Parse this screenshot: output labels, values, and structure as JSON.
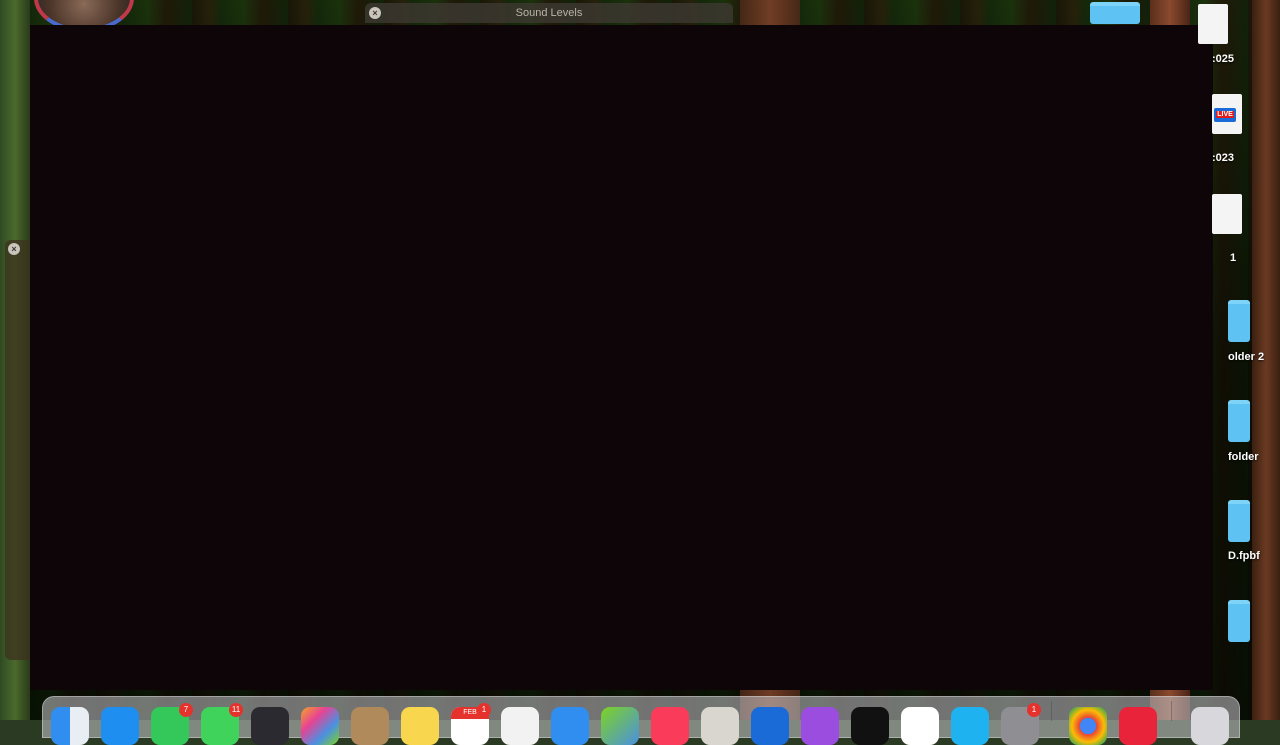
{
  "window": {
    "title": "Sound Levels"
  },
  "desktop_icons": [
    {
      "label": ":025",
      "kind": "document"
    },
    {
      "label": ":023",
      "kind": "document-live"
    },
    {
      "label": "1",
      "kind": "document"
    },
    {
      "label": "older 2",
      "kind": "folder"
    },
    {
      "label": "folder",
      "kind": "folder"
    },
    {
      "label": "D.fpbf",
      "kind": "folder"
    },
    {
      "label": "",
      "kind": "folder"
    }
  ],
  "dock": {
    "badges": {
      "facetime": "7",
      "messages": "11",
      "calendar": "1",
      "settings": "1"
    },
    "calendar_month": "FEB",
    "live_label": "LIVE"
  },
  "colors": {
    "window_bg": "#0d0507",
    "folder": "#5ec3f2",
    "badge": "#e5322d"
  }
}
